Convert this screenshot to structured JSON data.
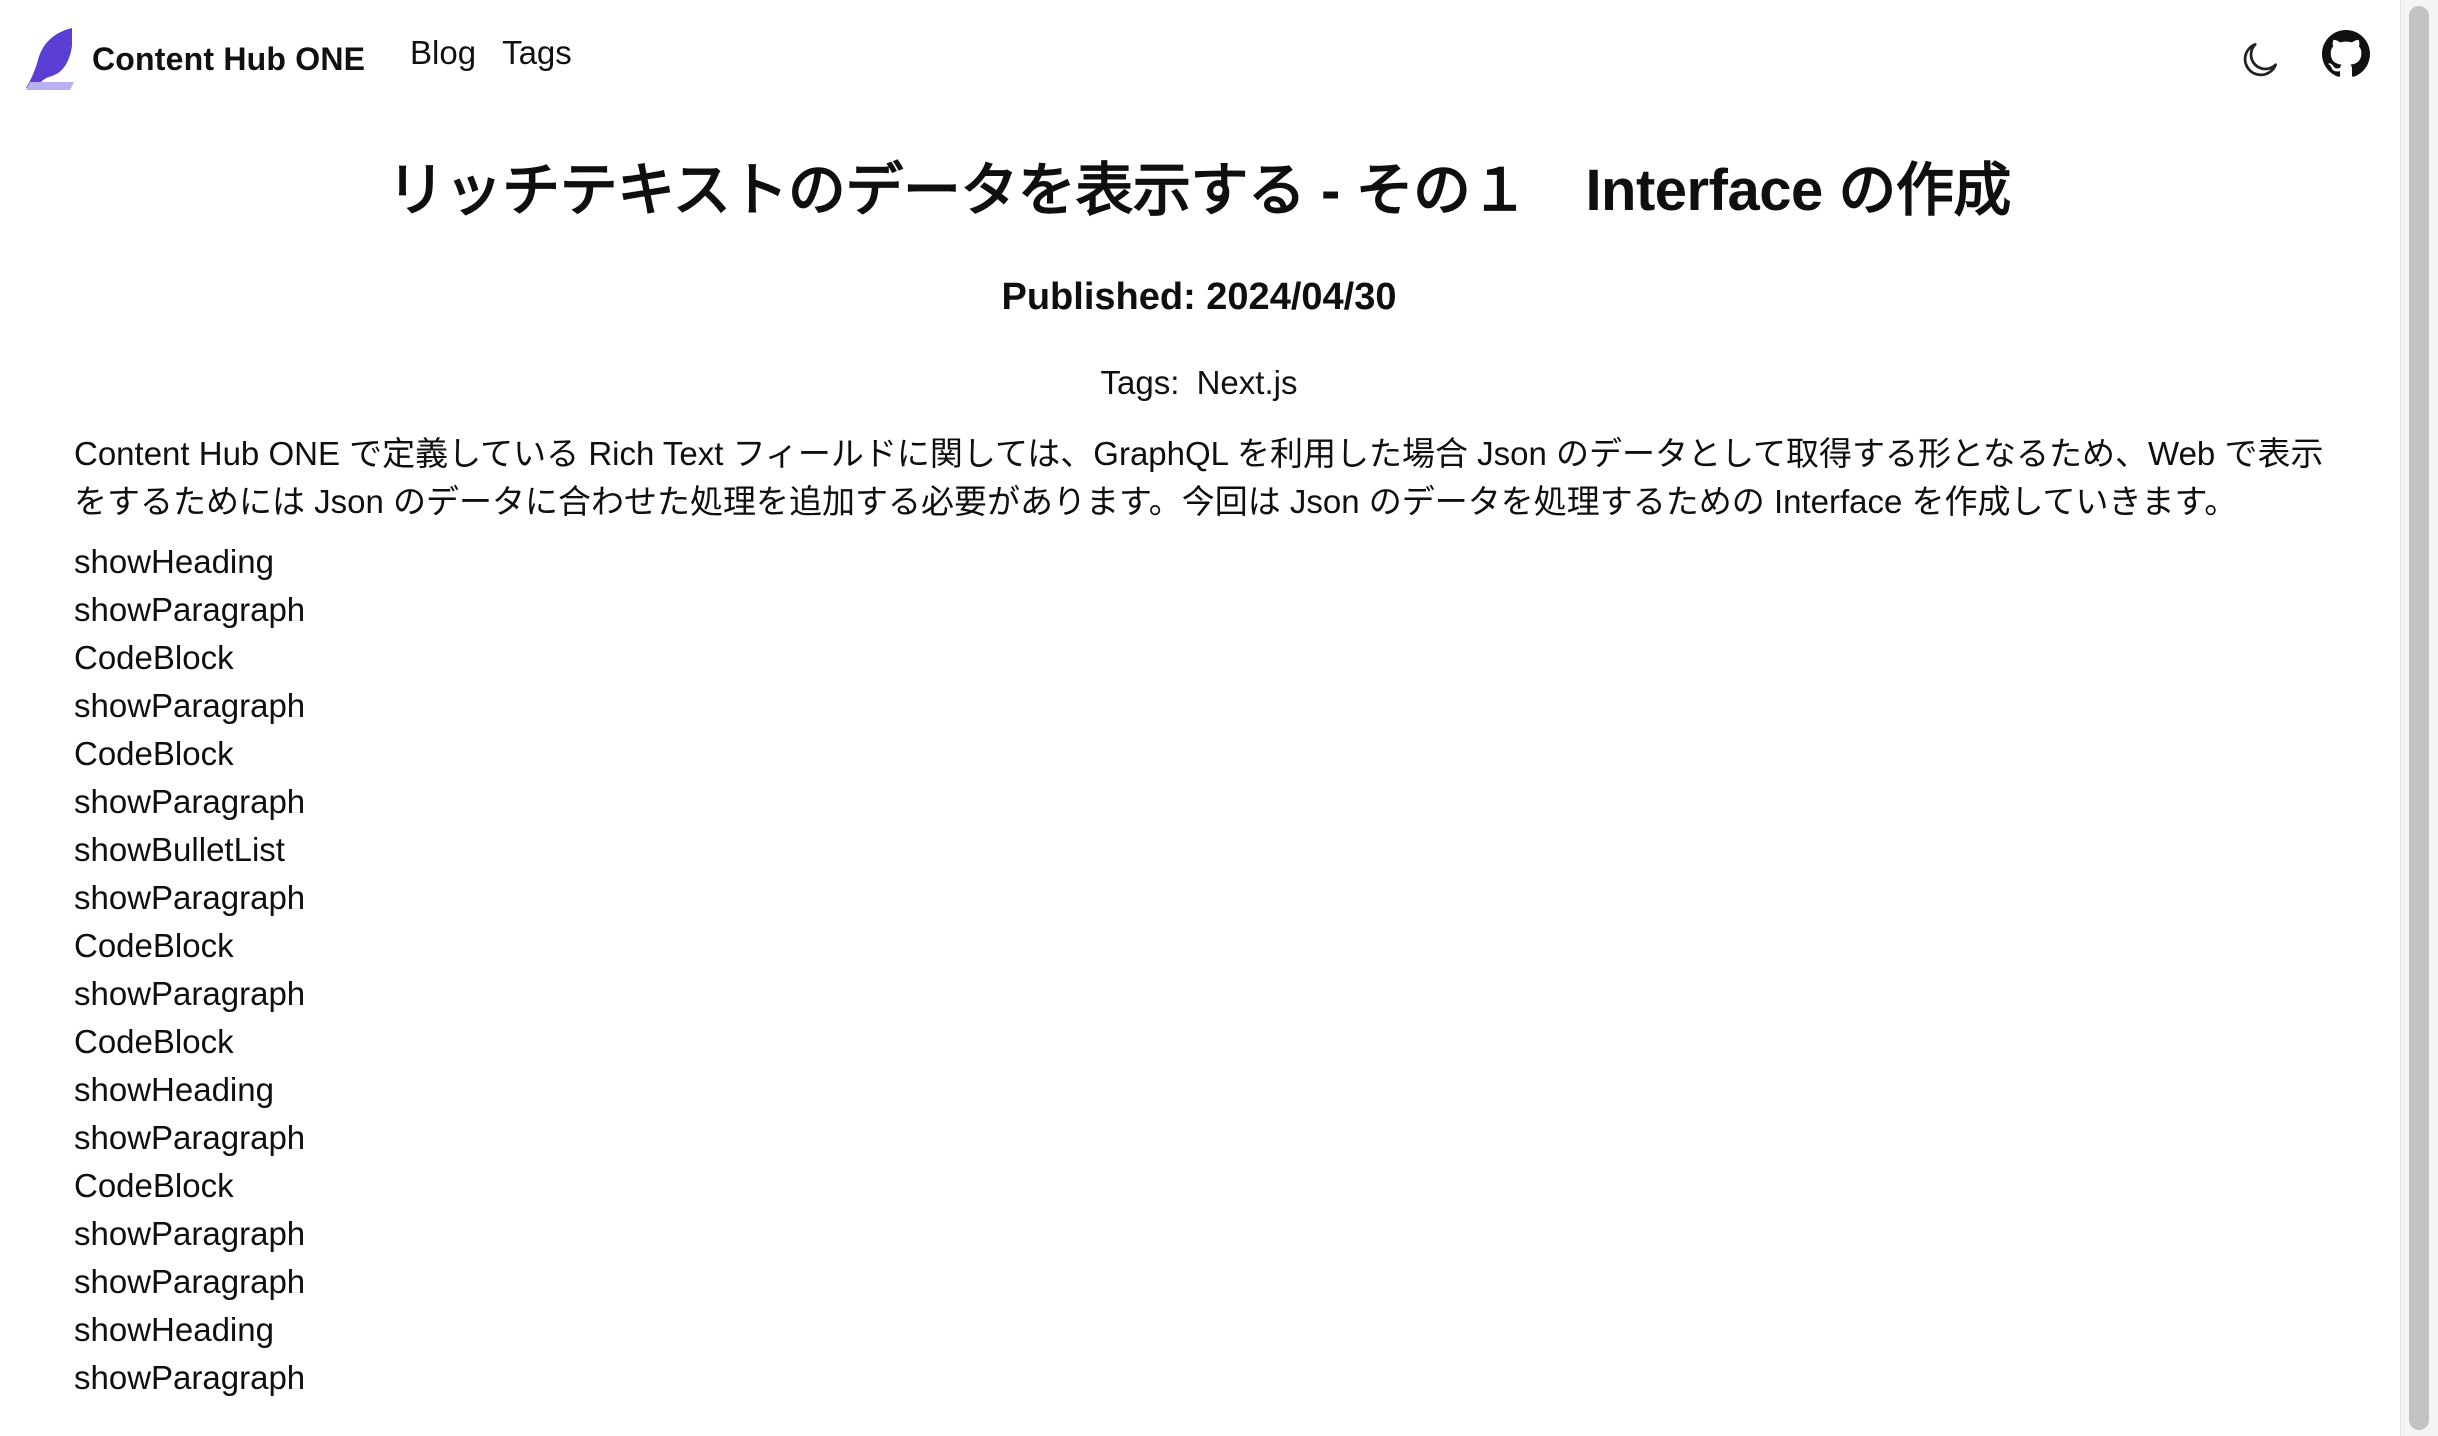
{
  "header": {
    "brand": "Content Hub ONE",
    "nav": [
      {
        "label": "Blog"
      },
      {
        "label": "Tags"
      }
    ],
    "icons": {
      "theme_toggle": "moon-icon",
      "github": "github-icon"
    }
  },
  "article": {
    "title": "リッチテキストのデータを表示する - その１　Interface の作成",
    "published": "Published: 2024/04/30",
    "tags_label": "Tags:",
    "tags": [
      "Next.js"
    ],
    "intro": "Content Hub ONE で定義している Rich Text フィールドに関しては、GraphQL を利用した場合 Json のデータとして取得する形となるため、Web で表示をするためには Json のデータに合わせた処理を追加する必要があります。今回は Json のデータを処理するための Interface を作成していきます。",
    "blocks": [
      "showHeading",
      "showParagraph",
      "CodeBlock",
      "showParagraph",
      "CodeBlock",
      "showParagraph",
      "showBulletList",
      "showParagraph",
      "CodeBlock",
      "showParagraph",
      "CodeBlock",
      "showHeading",
      "showParagraph",
      "CodeBlock",
      "showParagraph",
      "showParagraph",
      "showHeading",
      "showParagraph"
    ]
  },
  "colors": {
    "brand_purple": "#5b3ed6",
    "brand_lavender": "#b8b0f0",
    "text": "#0f0f0f"
  }
}
